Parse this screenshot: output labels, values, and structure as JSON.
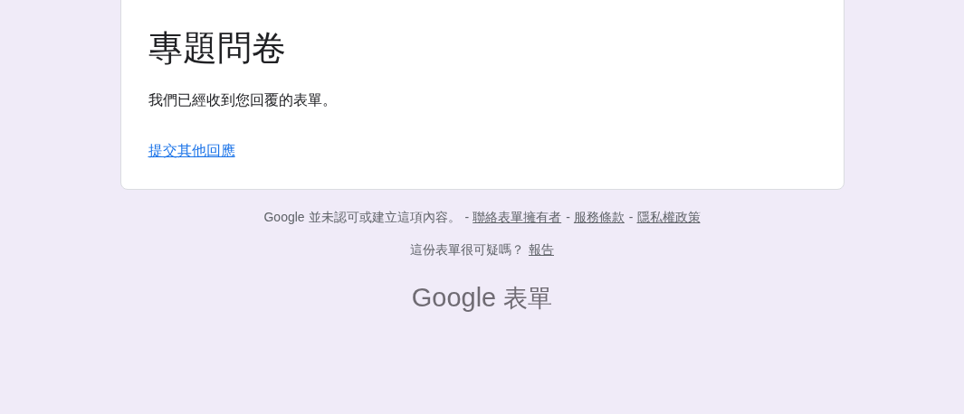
{
  "card": {
    "title": "專題問卷",
    "message": "我們已經收到您回覆的表單。",
    "link": "提交其他回應"
  },
  "footer": {
    "disclaimer": "Google 並未認可或建立這項內容。",
    "links": [
      {
        "separator": "-",
        "text": "聯絡表單擁有者"
      },
      {
        "separator": "-",
        "text": "服務條款"
      },
      {
        "separator": "-",
        "text": "隱私權政策"
      }
    ],
    "report_question": "這份表單很可疑嗎？",
    "report_link": "報告"
  },
  "logo": {
    "brand": "Google",
    "product": "表單"
  }
}
